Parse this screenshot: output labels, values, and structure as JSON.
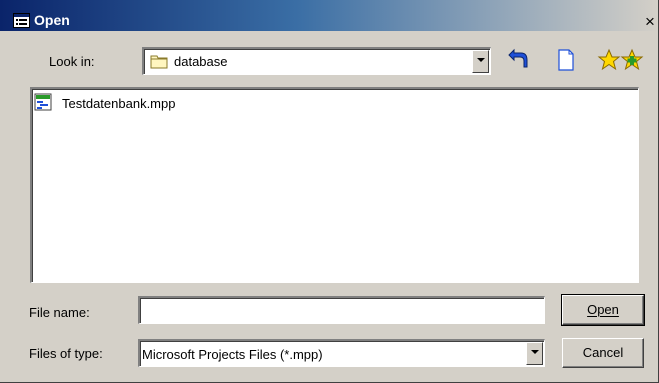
{
  "window": {
    "title": "Open",
    "close_glyph": "×"
  },
  "look_in": {
    "label": "Look in:",
    "value": "database",
    "icon": "folder-icon"
  },
  "toolbar": {
    "buttons": [
      {
        "name": "up-one-level-icon"
      },
      {
        "name": "create-new-folder-icon"
      },
      {
        "name": "favorites-star-icon"
      },
      {
        "name": "add-to-favorites-icon"
      }
    ]
  },
  "file_list": {
    "items": [
      {
        "name": "Testdatenbank.mpp",
        "icon": "mpp-file-icon"
      }
    ]
  },
  "file_name": {
    "label": "File name:",
    "value": ""
  },
  "files_of_type": {
    "label": "Files of type:",
    "value": "Microsoft Projects Files (*.mpp)"
  },
  "buttons": {
    "open": "Open",
    "cancel": "Cancel"
  }
}
